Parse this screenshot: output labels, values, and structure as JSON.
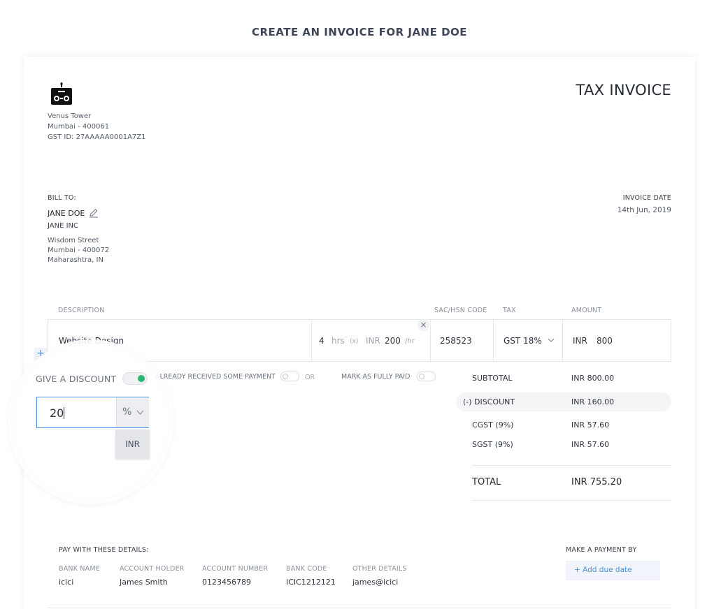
{
  "page": {
    "title": "CREATE AN INVOICE FOR JANE DOE"
  },
  "invoice": {
    "title": "TAX INVOICE"
  },
  "company": {
    "address_line1": "Venus Tower",
    "address_line2": "Mumbai - 400061",
    "gst": "GST ID: 27AAAAA0001A7Z1"
  },
  "bill_to": {
    "label": "BILL TO:",
    "name": "JANE DOE",
    "company": "JANE INC",
    "address_line1": "Wisdom Street",
    "address_line2": "Mumbai - 400072",
    "address_line3": "Maharashtra, IN"
  },
  "invoice_date": {
    "label": "INVOICE DATE",
    "value": "14th Jun, 2019"
  },
  "table": {
    "headers": {
      "description": "DESCRIPTION",
      "sac": "SAC/HSN CODE",
      "tax": "TAX",
      "amount": "AMOUNT"
    },
    "row": {
      "description": "Website Design",
      "qty": "4",
      "qty_unit": "hrs",
      "times": "(x)",
      "currency": "INR",
      "rate": "200",
      "rate_unit": "/hr",
      "sac": "258523",
      "tax": "GST 18%",
      "amount_currency": "INR",
      "amount": "800"
    },
    "remove_glyph": "×",
    "add_glyph": "+"
  },
  "options": {
    "discount_label": "GIVE A DISCOUNT",
    "discount_toggle_on": true,
    "received_label": "ALREADY RECEIVED SOME PAYMENT",
    "or_label": "OR",
    "paid_label": "MARK AS FULLY PAID"
  },
  "discount": {
    "value": "20",
    "unit": "%",
    "options": [
      "INR"
    ]
  },
  "summary": {
    "subtotal_label": "SUBTOTAL",
    "subtotal": "INR 800.00",
    "discount_label": "(-) DISCOUNT",
    "discount": "INR 160.00",
    "cgst_label": "CGST (9%)",
    "cgst": "INR 57.60",
    "sgst_label": "SGST (9%)",
    "sgst": "INR 57.60",
    "total_label": "TOTAL",
    "total": "INR 755.20"
  },
  "payment": {
    "title": "PAY WITH THESE DETAILS:",
    "bank_name_label": "BANK NAME",
    "bank_name": "icici",
    "holder_label": "ACCOUNT HOLDER",
    "holder": "James Smith",
    "number_label": "ACCOUNT NUMBER",
    "number": "0123456789",
    "code_label": "BANK CODE",
    "code": "ICIC1212121",
    "other_label": "OTHER DETAILS",
    "other": "james@icici",
    "due_label": "MAKE A PAYMENT BY",
    "due_button": "+ Add due date"
  },
  "colors": {
    "accent": "#4a90e2",
    "toggle_on": "#2bb673"
  }
}
